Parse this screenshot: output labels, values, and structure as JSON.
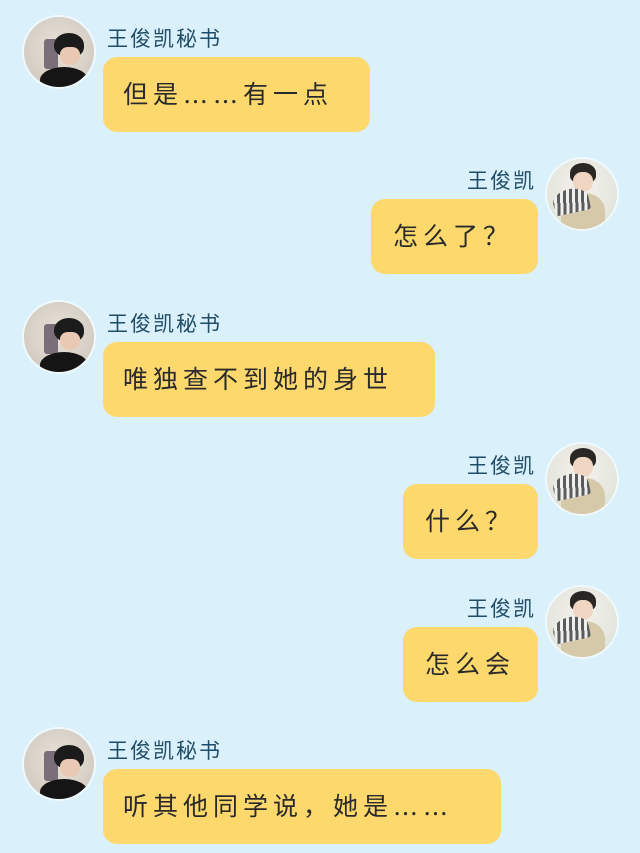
{
  "chat": {
    "messages": [
      {
        "sender": "王俊凯秘书",
        "side": "left",
        "avatar": "secretary",
        "text": "但是……有一点"
      },
      {
        "sender": "王俊凯",
        "side": "right",
        "avatar": "karry",
        "text": "怎么了？"
      },
      {
        "sender": "王俊凯秘书",
        "side": "left",
        "avatar": "secretary",
        "text": "唯独查不到她的身世"
      },
      {
        "sender": "王俊凯",
        "side": "right",
        "avatar": "karry",
        "text": "什么？"
      },
      {
        "sender": "王俊凯",
        "side": "right",
        "avatar": "karry",
        "text": "怎么会"
      },
      {
        "sender": "王俊凯秘书",
        "side": "left",
        "avatar": "secretary",
        "text": "听其他同学说，她是……"
      }
    ]
  },
  "colors": {
    "background": "#daf0fa",
    "bubble": "#fcd86d",
    "name_text": "#1f4c66",
    "message_text": "#2a2a2a"
  }
}
